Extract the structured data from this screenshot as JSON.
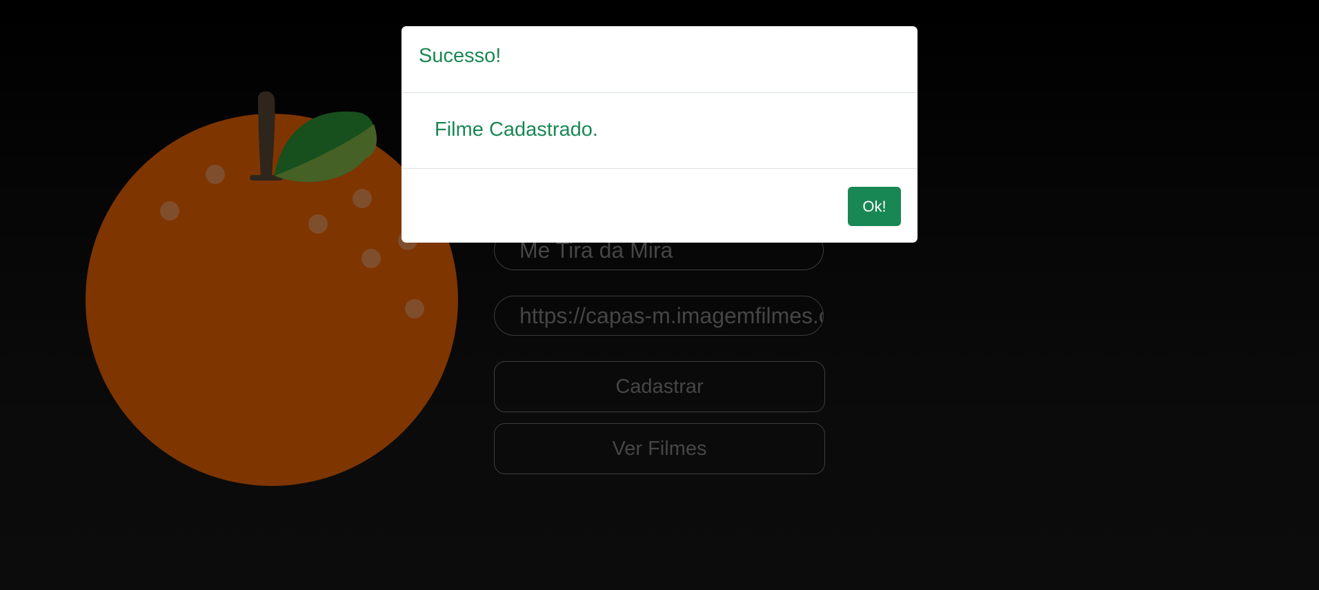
{
  "form": {
    "title_value": "Me Tira da Mira",
    "url_value": "https://capas-m.imagemfilmes.com.br",
    "register_label": "Cadastrar",
    "view_label": "Ver Filmes"
  },
  "modal": {
    "title": "Sucesso!",
    "message": "Filme Cadastrado.",
    "ok_label": "Ok!"
  },
  "illustration": {
    "icon": "orange-fruit-icon"
  },
  "colors": {
    "success": "#198754",
    "orange": "#ff6a00",
    "leaf": "#2e9e3a",
    "stem": "#5c4a3a"
  }
}
